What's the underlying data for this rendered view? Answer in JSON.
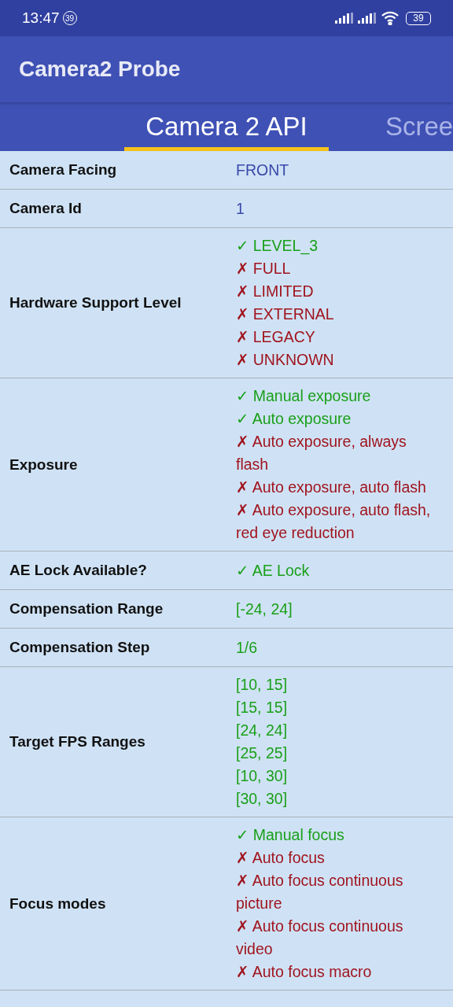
{
  "status_bar": {
    "time": "13:47",
    "notification_badge": "39",
    "battery": "39"
  },
  "app_bar": {
    "title": "Camera2 Probe"
  },
  "tabs": [
    {
      "label": "Camera 2 API",
      "selected": true
    },
    {
      "label": "Scree",
      "selected": false
    }
  ],
  "rows": [
    {
      "label": "Camera Facing",
      "values": [
        {
          "text": "FRONT",
          "kind": "info"
        }
      ]
    },
    {
      "label": "Camera Id",
      "values": [
        {
          "text": "1",
          "kind": "info"
        }
      ]
    },
    {
      "label": "Hardware Support Level",
      "values": [
        {
          "text": "✓ LEVEL_3",
          "kind": "yes"
        },
        {
          "text": "✗ FULL",
          "kind": "no"
        },
        {
          "text": "✗ LIMITED",
          "kind": "no"
        },
        {
          "text": "✗ EXTERNAL",
          "kind": "no"
        },
        {
          "text": "✗ LEGACY",
          "kind": "no"
        },
        {
          "text": "✗ UNKNOWN",
          "kind": "no"
        }
      ]
    },
    {
      "label": "Exposure",
      "values": [
        {
          "text": "✓ Manual exposure",
          "kind": "yes"
        },
        {
          "text": "✓ Auto exposure",
          "kind": "yes"
        },
        {
          "text": "✗ Auto exposure, always flash",
          "kind": "no"
        },
        {
          "text": "✗ Auto exposure, auto flash",
          "kind": "no"
        },
        {
          "text": "✗ Auto exposure, auto flash, red eye reduction",
          "kind": "no"
        }
      ]
    },
    {
      "label": "AE Lock Available?",
      "values": [
        {
          "text": "✓ AE Lock",
          "kind": "yes"
        }
      ]
    },
    {
      "label": "Compensation Range",
      "values": [
        {
          "text": "[-24, 24]",
          "kind": "plain"
        }
      ]
    },
    {
      "label": "Compensation Step",
      "values": [
        {
          "text": "1/6",
          "kind": "plain"
        }
      ]
    },
    {
      "label": "Target FPS Ranges",
      "values": [
        {
          "text": "[10, 15]",
          "kind": "plain"
        },
        {
          "text": "[15, 15]",
          "kind": "plain"
        },
        {
          "text": "[24, 24]",
          "kind": "plain"
        },
        {
          "text": "[25, 25]",
          "kind": "plain"
        },
        {
          "text": "[10, 30]",
          "kind": "plain"
        },
        {
          "text": "[30, 30]",
          "kind": "plain"
        }
      ]
    },
    {
      "label": "Focus modes",
      "values": [
        {
          "text": "✓ Manual focus",
          "kind": "yes"
        },
        {
          "text": "✗ Auto focus",
          "kind": "no"
        },
        {
          "text": "✗ Auto focus continuous picture",
          "kind": "no"
        },
        {
          "text": "✗ Auto focus continuous video",
          "kind": "no"
        },
        {
          "text": "✗ Auto focus macro",
          "kind": "no"
        }
      ]
    }
  ]
}
